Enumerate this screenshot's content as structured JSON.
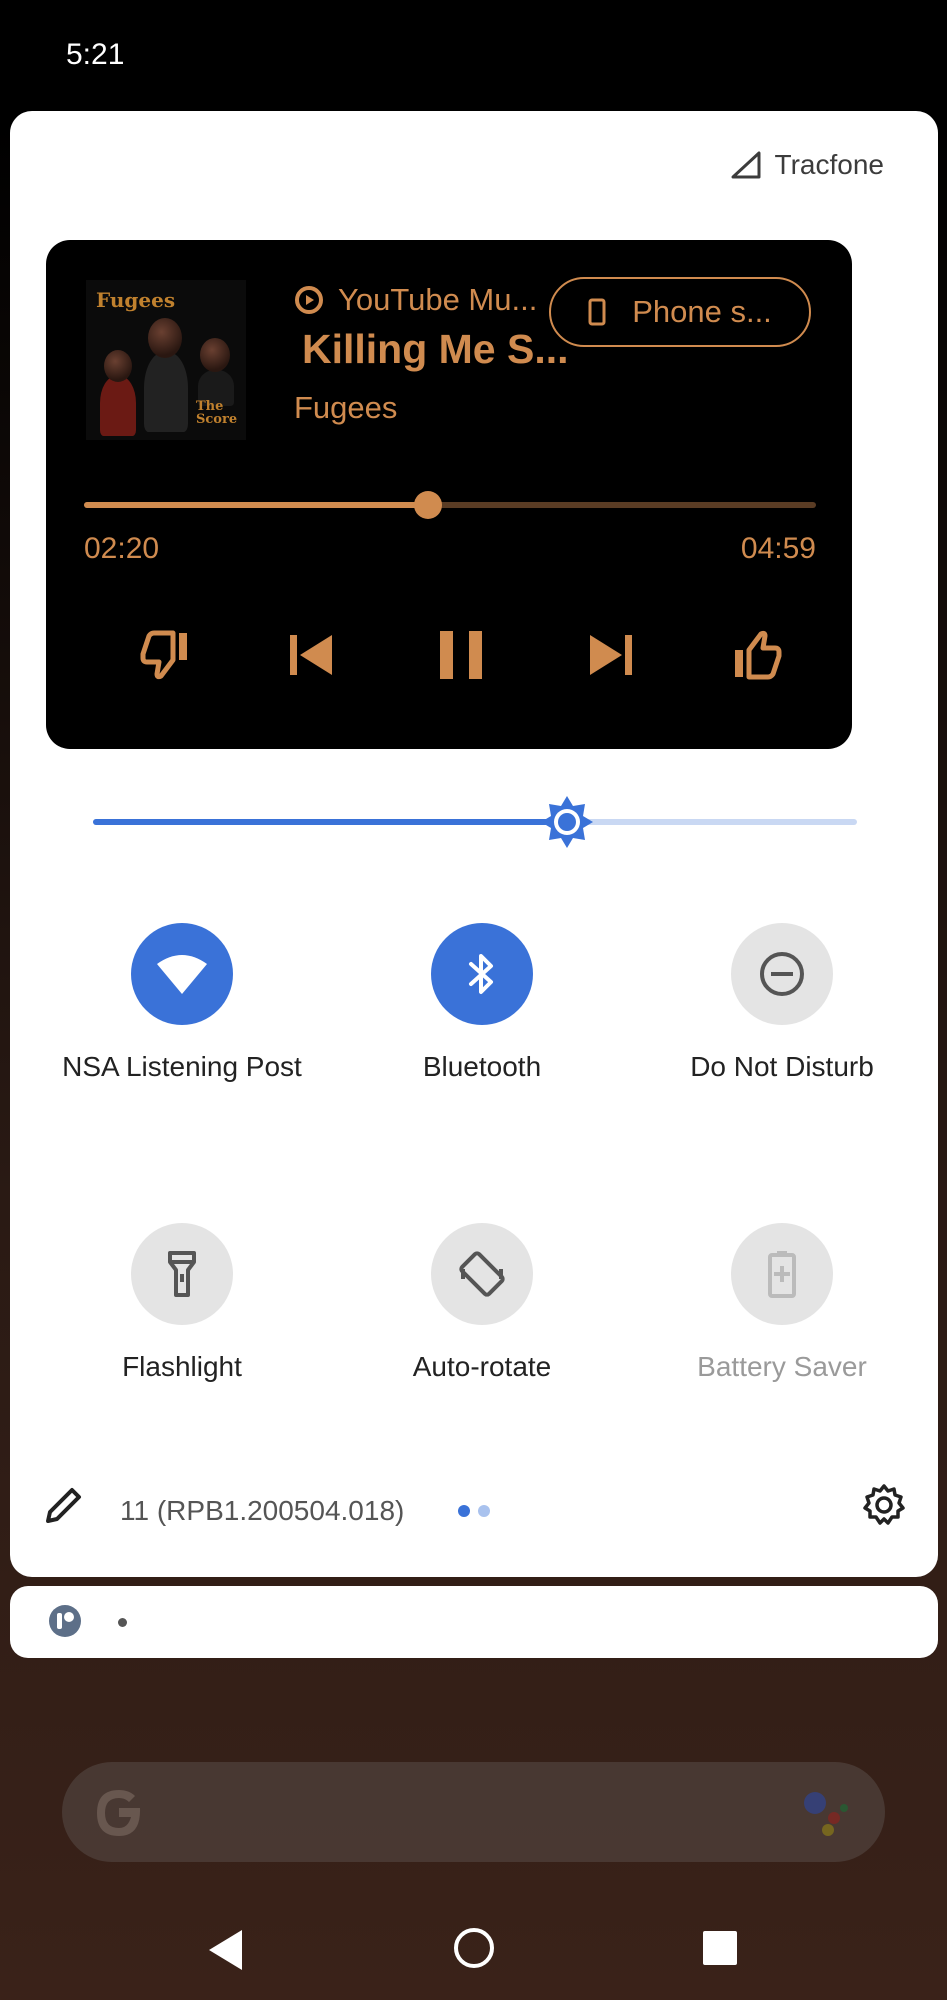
{
  "status_bar": {
    "time": "5:21"
  },
  "carrier": {
    "name": "Tracfone"
  },
  "media": {
    "app_name": "YouTube Mu...",
    "song_title": "Killing Me S...",
    "artist": "Fugees",
    "output_device": "Phone s...",
    "elapsed": "02:20",
    "duration": "04:59",
    "progress": 0.47,
    "album_art_text": [
      "Fugees",
      "The Score"
    ],
    "accent_color": "#d08b4f",
    "controls": [
      "thumbs-down-icon",
      "previous-icon",
      "pause-icon",
      "next-icon",
      "thumbs-up-icon"
    ]
  },
  "brightness": {
    "level": 0.62,
    "accent_color": "#3a72d8"
  },
  "tiles": [
    {
      "label": "NSA Listening Post",
      "state": "on",
      "icon": "wifi-icon"
    },
    {
      "label": "Bluetooth",
      "state": "on",
      "icon": "bluetooth-icon"
    },
    {
      "label": "Do Not Disturb",
      "state": "off",
      "icon": "do-not-disturb-icon"
    },
    {
      "label": "Flashlight",
      "state": "off",
      "icon": "flashlight-icon"
    },
    {
      "label": "Auto-rotate",
      "state": "off",
      "icon": "auto-rotate-icon"
    },
    {
      "label": "Battery Saver",
      "state": "unavailable",
      "icon": "battery-saver-icon"
    }
  ],
  "footer": {
    "build": "11 (RPB1.200504.018)",
    "page_count": 2,
    "current_page": 1
  },
  "notification": {
    "app_icon": "app-icon"
  },
  "home": {
    "search_icon": "google-g-icon",
    "assistant_icon": "assistant-dots-icon"
  },
  "nav": [
    "back-icon",
    "home-icon",
    "recents-icon"
  ]
}
